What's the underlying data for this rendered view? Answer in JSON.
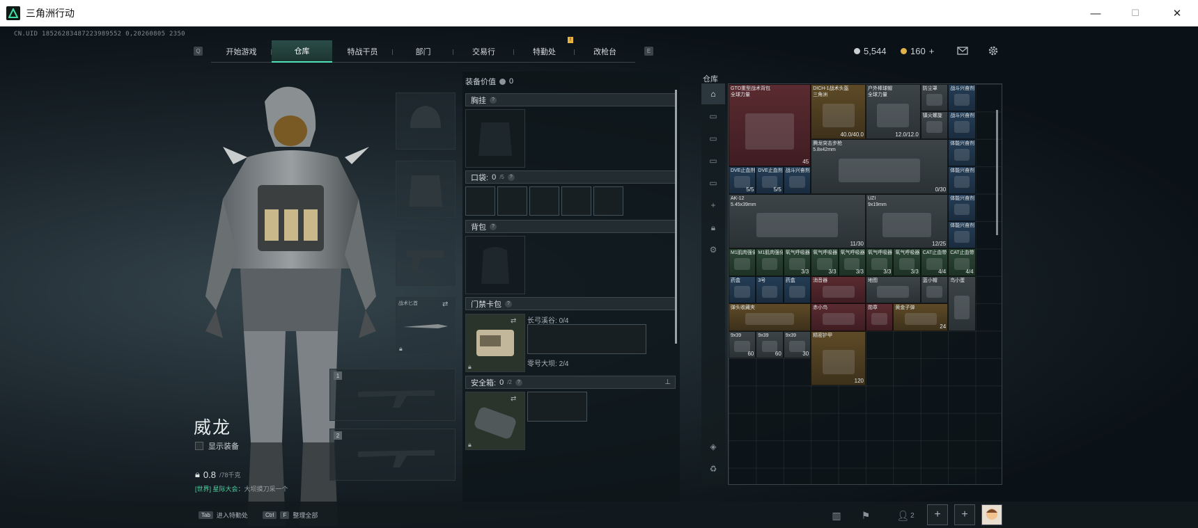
{
  "window": {
    "title": "三角洲行动",
    "minimize": "—",
    "maximize": "☐",
    "close": "✕"
  },
  "uid": "CN.UID 18526283487223989552 0,20260805 2350",
  "nav": {
    "left_key": "Q",
    "right_key": "E",
    "tabs": [
      "开始游戏",
      "仓库",
      "特战干员",
      "部门",
      "交易行",
      "特勤处",
      "改枪台"
    ],
    "active": "仓库",
    "badge": "!"
  },
  "currency": {
    "silver": "5,544",
    "gold": "160",
    "add": "+"
  },
  "operator": {
    "name": "威龙",
    "show_equipment": "显示装备",
    "weight": "0.8",
    "weight_max": "/78千克",
    "world_msg_prefix": "[世界] 星际大会",
    "world_msg": "：大坝摸刀采一个"
  },
  "weapon_slots": [
    {
      "num": "1"
    },
    {
      "num": "2"
    }
  ],
  "loadout": {
    "value_label": "装备价值",
    "value": "0",
    "chest": {
      "label": "胸挂"
    },
    "pocket": {
      "label": "口袋:",
      "count": "0",
      "max": "/5"
    },
    "backpack": {
      "label": "背包"
    },
    "keycard": {
      "label": "门禁卡包",
      "row1_name": "长弓溪谷:",
      "row1_count": "0/4",
      "row2_name": "零号大坝:",
      "row2_count": "2/4"
    },
    "safebox": {
      "label": "安全箱:",
      "count": "0",
      "max": "/2"
    }
  },
  "warehouse": {
    "label": "仓库",
    "items": [
      {
        "name": "GTO重型战术背包\n全球力量",
        "count": "45",
        "rarity": "r-red"
      },
      {
        "name": "DICH-1战术头盔\n三角洲",
        "count": "40.0/40.0",
        "rarity": "r-gold"
      },
      {
        "name": "户外棒球帽\n全球力量",
        "count": "12.0/12.0",
        "rarity": "r-gray"
      },
      {
        "name": "防尘罩",
        "count": "",
        "rarity": "r-gray"
      },
      {
        "name": "镇火螺旋",
        "count": "",
        "rarity": "r-gray"
      },
      {
        "name": "战斗兴奋剂",
        "count": "",
        "rarity": "r-blue"
      },
      {
        "name": "战斗兴奋剂",
        "count": "",
        "rarity": "r-blue"
      },
      {
        "name": "体能兴奋剂",
        "count": "",
        "rarity": "r-blue"
      },
      {
        "name": "体能兴奋剂",
        "count": "",
        "rarity": "r-blue"
      },
      {
        "name": "体能兴奋剂",
        "count": "",
        "rarity": "r-blue"
      },
      {
        "name": "体能兴奋剂",
        "count": "",
        "rarity": "r-blue"
      },
      {
        "name": "腾龙突击步枪\n5.8x42mm",
        "count": "0/30",
        "rarity": "r-gray"
      },
      {
        "name": "DVE止血剂",
        "count": "5/5",
        "rarity": "r-blue"
      },
      {
        "name": "DVE止血剂",
        "count": "5/5",
        "rarity": "r-blue"
      },
      {
        "name": "战斗兴奋剂",
        "count": "",
        "rarity": "r-blue"
      },
      {
        "name": "AK-12\n5.45x39mm",
        "count": "11/30",
        "rarity": "r-gray"
      },
      {
        "name": "UZI\n9x19mm",
        "count": "12/25",
        "rarity": "r-gray"
      },
      {
        "name": "M1肌肉强化",
        "count": "",
        "rarity": "r-green"
      },
      {
        "name": "M1肌肉强化",
        "count": "",
        "rarity": "r-green"
      },
      {
        "name": "氧气呼吸器",
        "count": "3/3",
        "rarity": "r-green"
      },
      {
        "name": "氧气呼吸器",
        "count": "3/3",
        "rarity": "r-green"
      },
      {
        "name": "氧气呼吸器",
        "count": "3/3",
        "rarity": "r-green"
      },
      {
        "name": "氧气呼吸器",
        "count": "3/3",
        "rarity": "r-green"
      },
      {
        "name": "氧气呼吸器",
        "count": "3/3",
        "rarity": "r-green"
      },
      {
        "name": "CAT止血带",
        "count": "4/4",
        "rarity": "r-green"
      },
      {
        "name": "CAT止血带",
        "count": "4/4",
        "rarity": "r-green"
      },
      {
        "name": "药盒",
        "count": "",
        "rarity": "r-blue"
      },
      {
        "name": "3号",
        "count": "",
        "rarity": "r-blue"
      },
      {
        "name": "药盒",
        "count": "",
        "rarity": "r-blue"
      },
      {
        "name": "消音器",
        "count": "",
        "rarity": "r-red"
      },
      {
        "name": "地图",
        "count": "",
        "rarity": "r-gray"
      },
      {
        "name": "蓝小帽",
        "count": "",
        "rarity": "r-gray"
      },
      {
        "name": "鸟小蛋",
        "count": "",
        "rarity": "r-gray"
      },
      {
        "name": "弹头收藏夹",
        "count": "",
        "rarity": "r-gold"
      },
      {
        "name": "赤小鸟",
        "count": "",
        "rarity": "r-red"
      },
      {
        "name": "勋章",
        "count": "",
        "rarity": "r-red"
      },
      {
        "name": "黄金子弹",
        "count": "24",
        "rarity": "r-gold"
      },
      {
        "name": "9x39",
        "count": "60",
        "rarity": "r-gray"
      },
      {
        "name": "9x39",
        "count": "60",
        "rarity": "r-gray"
      },
      {
        "name": "9x39",
        "count": "30",
        "rarity": "r-gray"
      },
      {
        "name": "精密护甲",
        "count": "120",
        "rarity": "r-gold"
      }
    ]
  },
  "bottom": {
    "hint1_key": "Tab",
    "hint1": "进入特勤处",
    "hint2_key": "Ctrl",
    "hint2_key2": "F",
    "hint2": "整理全部",
    "friends_count": "2"
  },
  "colors": {
    "accent": "#52e2b9",
    "badge": "#e8b341"
  }
}
